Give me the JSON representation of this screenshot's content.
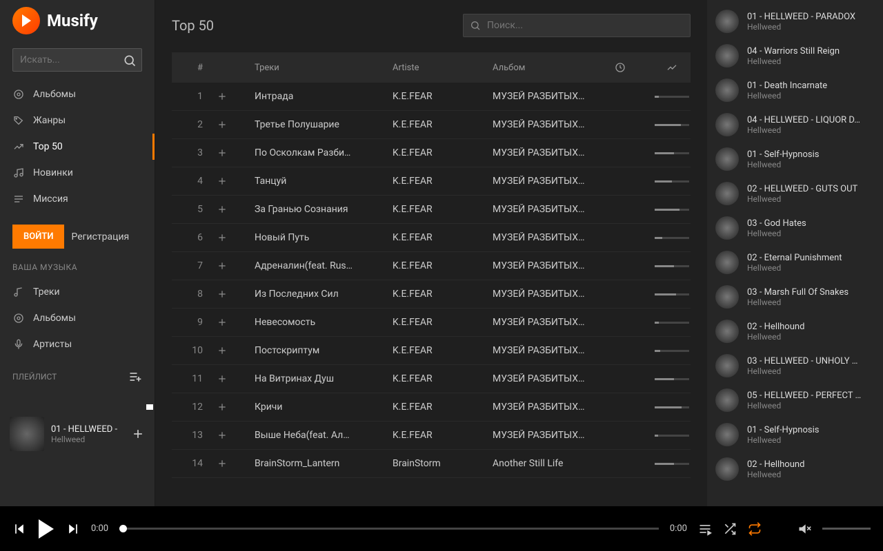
{
  "app_name": "Musify",
  "sidebar": {
    "search_placeholder": "Искать...",
    "nav": [
      {
        "icon": "disc",
        "label": "Альбомы"
      },
      {
        "icon": "tag",
        "label": "Жанры"
      },
      {
        "icon": "trend",
        "label": "Top 50"
      },
      {
        "icon": "music",
        "label": "Новинки"
      },
      {
        "icon": "playlist",
        "label": "Миссия"
      }
    ],
    "login_btn": "ВОЙТИ",
    "register_link": "Регистрация",
    "your_music_label": "ВАША МУЗЫКА",
    "library": [
      {
        "icon": "note",
        "label": "Треки"
      },
      {
        "icon": "disc",
        "label": "Альбомы"
      },
      {
        "icon": "mic",
        "label": "Артисты"
      }
    ],
    "playlist_label": "ПЛЕЙЛИСТ"
  },
  "now_playing": {
    "title": "01 - HELLWEED -",
    "artist": "Hellweed"
  },
  "main": {
    "title": "Top 50",
    "search_placeholder": "Поиск...",
    "columns": {
      "idx": "#",
      "track": "Треки",
      "artist": "Artiste",
      "album": "Альбом"
    },
    "tracks": [
      {
        "n": 1,
        "track": "Интрада<br/>",
        "artist": "K.E.FEAR",
        "album": "МУЗЕЙ РАЗБИТЫХ …",
        "pop": 12
      },
      {
        "n": 2,
        "track": "Третье Полушарие",
        "artist": "K.E.FEAR",
        "album": "МУЗЕЙ РАЗБИТЫХ …",
        "pop": 75
      },
      {
        "n": 3,
        "track": "По Осколкам Разби…",
        "artist": "K.E.FEAR",
        "album": "МУЗЕЙ РАЗБИТЫХ …",
        "pop": 55
      },
      {
        "n": 4,
        "track": "Танцуй",
        "artist": "K.E.FEAR",
        "album": "МУЗЕЙ РАЗБИТЫХ …",
        "pop": 50
      },
      {
        "n": 5,
        "track": "За Гранью Сознания",
        "artist": "K.E.FEAR",
        "album": "МУЗЕЙ РАЗБИТЫХ …",
        "pop": 72
      },
      {
        "n": 6,
        "track": "Новый Путь",
        "artist": "K.E.FEAR",
        "album": "МУЗЕЙ РАЗБИТЫХ …",
        "pop": 22
      },
      {
        "n": 7,
        "track": "Адреналин(feat. Rus…",
        "artist": "K.E.FEAR",
        "album": "МУЗЕЙ РАЗБИТЫХ …",
        "pop": 55
      },
      {
        "n": 8,
        "track": "Из Последних Сил",
        "artist": "K.E.FEAR",
        "album": "МУЗЕЙ РАЗБИТЫХ …",
        "pop": 62
      },
      {
        "n": 9,
        "track": "Невесомость",
        "artist": "K.E.FEAR",
        "album": "МУЗЕЙ РАЗБИТЫХ …",
        "pop": 12
      },
      {
        "n": 10,
        "track": "Постскриптум",
        "artist": "K.E.FEAR",
        "album": "МУЗЕЙ РАЗБИТЫХ …",
        "pop": 15
      },
      {
        "n": 11,
        "track": "На Витринах Душ",
        "artist": "K.E.FEAR",
        "album": "МУЗЕЙ РАЗБИТЫХ …",
        "pop": 55
      },
      {
        "n": 12,
        "track": "Кричи",
        "artist": "K.E.FEAR",
        "album": "МУЗЕЙ РАЗБИТЫХ …",
        "pop": 78
      },
      {
        "n": 13,
        "track": "Выше Неба(feat. Ал…",
        "artist": "K.E.FEAR",
        "album": "МУЗЕЙ РАЗБИТЫХ …",
        "pop": 10
      },
      {
        "n": 14,
        "track": "BrainStorm_Lantern",
        "artist": "BrainStorm",
        "album": "Another Still Life",
        "pop": 55
      }
    ]
  },
  "queue": [
    {
      "title": "01 - HELLWEED - PARADOX",
      "artist": "Hellweed"
    },
    {
      "title": "04 - Warriors Still Reign",
      "artist": "Hellweed"
    },
    {
      "title": "01 - Death Incarnate",
      "artist": "Hellweed"
    },
    {
      "title": "04 - HELLWEED - LIQUOR D…",
      "artist": "Hellweed"
    },
    {
      "title": "01 - Self-Hypnosis",
      "artist": "Hellweed"
    },
    {
      "title": "02 - HELLWEED - GUTS OUT",
      "artist": "Hellweed"
    },
    {
      "title": "03 - God Hates",
      "artist": "Hellweed"
    },
    {
      "title": "02 - Eternal Punishment",
      "artist": "Hellweed"
    },
    {
      "title": "03 - Marsh Full Of Snakes",
      "artist": "Hellweed"
    },
    {
      "title": "02 - Hellhound",
      "artist": "Hellweed"
    },
    {
      "title": "03 - HELLWEED - UNHOLY …",
      "artist": "Hellweed"
    },
    {
      "title": "05 - HELLWEED - PERFECT …",
      "artist": "Hellweed"
    },
    {
      "title": "01 - Self-Hypnosis",
      "artist": "Hellweed"
    },
    {
      "title": "02 - Hellhound",
      "artist": "Hellweed"
    }
  ],
  "player": {
    "elapsed": "0:00",
    "duration": "0:00"
  }
}
